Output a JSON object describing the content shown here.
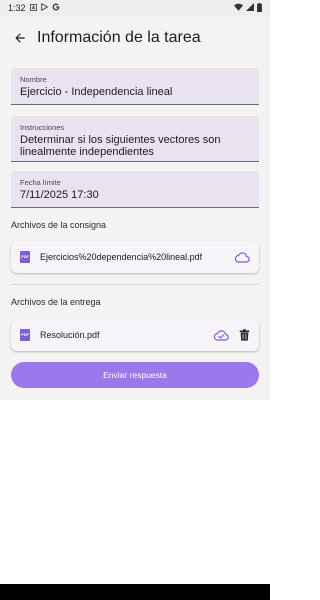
{
  "status_bar": {
    "time": "1:32",
    "icons": [
      "notification-a-icon",
      "play-store-icon",
      "google-icon",
      "wifi-icon",
      "signal-icon",
      "battery-icon"
    ]
  },
  "header": {
    "title": "Información de la tarea",
    "back_icon": "arrow-left-icon"
  },
  "fields": {
    "name": {
      "label": "Nombre",
      "value": "Ejercicio - Independencia lineal"
    },
    "instructions": {
      "label": "Instrucciones",
      "value": "Determinar si los siguientes vectores son linealmente independientes"
    },
    "due_date": {
      "label": "Fecha límite",
      "value": "7/11/2025 17:30"
    }
  },
  "assignment_files": {
    "title": "Archivos de la consigna",
    "files": [
      {
        "icon_text": "PDF",
        "name": "Ejercicios%20dependencia%20lineal.pdf",
        "action_icon": "cloud-download-icon"
      }
    ]
  },
  "submission_files": {
    "title": "Archivos de la entrega",
    "files": [
      {
        "icon_text": "PDF",
        "name": "Resolución.pdf",
        "action_icons": [
          "cloud-done-icon",
          "trash-icon"
        ]
      }
    ]
  },
  "submit_button": {
    "label": "Enviar respuesta"
  },
  "colors": {
    "accent": "#9b79ec",
    "pdf_icon": "#7e5fd1",
    "field_bg": "#e9e2ef",
    "background": "#f3f3f3"
  }
}
